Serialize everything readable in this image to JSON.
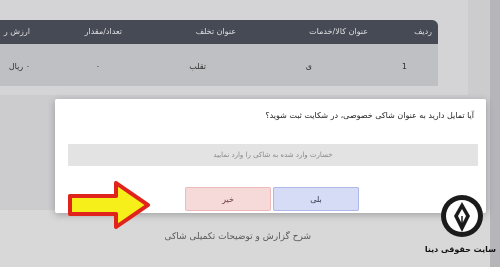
{
  "table": {
    "headers": {
      "row": "ردیف",
      "item": "عنوان کالا/خدمات",
      "violation": "عنوان تخلف",
      "count": "تعداد/مقدار",
      "value": "ارزش ر"
    },
    "row": {
      "row": "1",
      "item": "ی",
      "violation": "تقلب",
      "count": "۰",
      "value": "۰ ریال"
    }
  },
  "modal": {
    "question": "آیا تمایل دارید به عنوان شاکی خصوصی، در شکایت ثبت شوید؟",
    "input_placeholder": "خسارت وارد شده به شاکی را وارد نمایید",
    "yes_label": "بلی",
    "no_label": "خیر"
  },
  "bottom": {
    "label": "شرح گزارش و توضیحات تکمیلی شاکی"
  },
  "watermark": {
    "text": "سایت حقوقی دینا"
  },
  "colors": {
    "header_bg": "#4f5561",
    "yes_bg": "#d6dcf6",
    "no_bg": "#f6dada",
    "arrow_fill": "#f7ef1a",
    "arrow_stroke": "#e0241b"
  }
}
